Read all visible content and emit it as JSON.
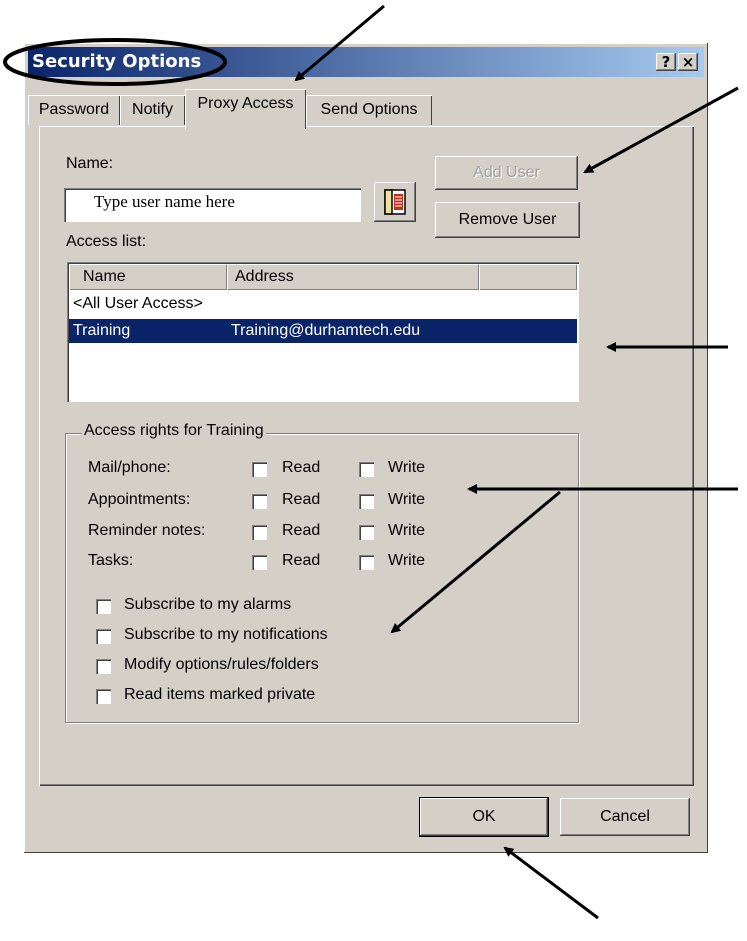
{
  "window": {
    "title": "Security Options",
    "help_button": "?",
    "close_button": "×"
  },
  "tabs": [
    "Password",
    "Notify",
    "Proxy Access",
    "Send Options"
  ],
  "active_tab": "Proxy Access",
  "form": {
    "name_label": "Name:",
    "name_input_value": "Type user name here",
    "add_user_button": "Add User",
    "remove_user_button": "Remove User",
    "access_list_label": "Access list:"
  },
  "access_list": {
    "columns": [
      "Name",
      "Address"
    ],
    "rows": [
      {
        "name": "<All User Access>",
        "address": ""
      },
      {
        "name": "Training",
        "address": "Training@durhamtech.edu",
        "selected": true
      }
    ]
  },
  "rights": {
    "group_title": "Access rights for Training",
    "read_label": "Read",
    "write_label": "Write",
    "items": [
      "Mail/phone:",
      "Appointments:",
      "Reminder notes:",
      "Tasks:"
    ],
    "options": [
      "Subscribe to my alarms",
      "Subscribe to my notifications",
      "Modify options/rules/folders",
      "Read items marked private"
    ]
  },
  "footer": {
    "ok_button": "OK",
    "cancel_button": "Cancel"
  },
  "colors": {
    "face": "#d4d0c8",
    "title_start": "#0a246a",
    "title_end": "#a6caf0",
    "selection": "#0a246a"
  }
}
